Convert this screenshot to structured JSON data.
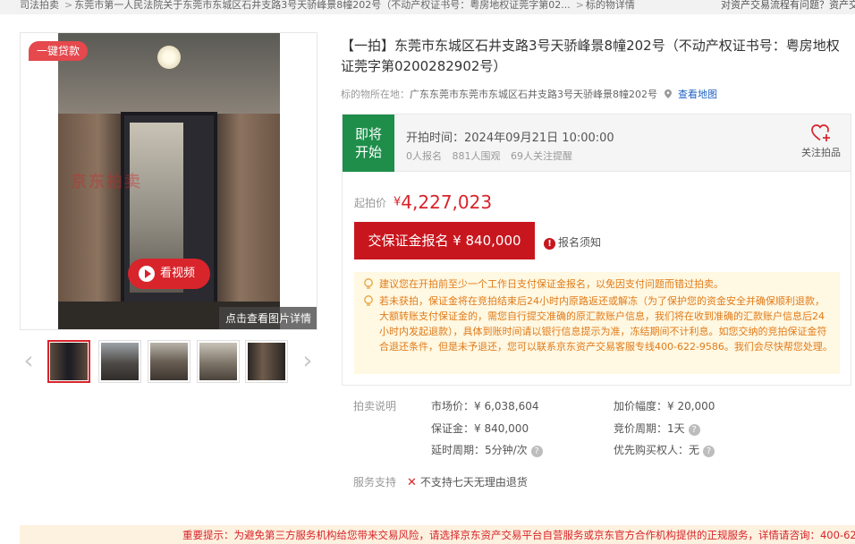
{
  "breadcrumb": {
    "items": [
      "司法拍卖",
      "东莞市第一人民法院关于东莞市东城区石井支路3号天骄峰景8幢202号（不动产权证书号：粤房地权证莞字第02...",
      "标的物详情"
    ],
    "separator": ">",
    "help_text": "对资产交易流程有问题？资产交"
  },
  "gallery": {
    "loan_badge": "一键贷款",
    "video_button": "看视频",
    "photo_detail_link": "点击查看图片详情",
    "watermark": "京东拍卖",
    "thumbnail_count": 5,
    "active_thumbnail": 1
  },
  "listing": {
    "title": "【一拍】东莞市东城区石井支路3号天骄峰景8幢202号（不动产权证书号：粤房地权证莞字第0200282902号）",
    "location_label": "标的物所在地：",
    "location_value": "广东东莞市东莞市东城区石井支路3号天骄峰景8幢202号",
    "map_link": "查看地图"
  },
  "auction": {
    "status_line1": "即将",
    "status_line2": "开始",
    "start_time": "开拍时间：2024年09月21日 10:00:00",
    "signups": "0人报名",
    "views": "881人围观",
    "reminders": "69人关注提醒",
    "follow_label": "关注拍品",
    "starting_price_label": "起拍价",
    "currency": "¥",
    "starting_price": "4,227,023",
    "deposit_button": "交保证金报名 ¥ 840,000",
    "notice_link": "报名须知",
    "tips": [
      "建议您在开拍前至少一个工作日支付保证金报名，以免因支付问题而错过拍卖。",
      "若未获拍，保证金将在竞拍结束后24小时内原路返还或解冻（为了保护您的资金安全并确保顺利退款，大额转账支付保证金的，需您自行提交准确的原汇款账户信息，我们将在收到准确的汇款账户信息后24小时内发起退款），具体到账时间请以银行信息提示为准，冻结期间不计利息。如您交纳的竞拍保证金符合退还条件，但是未予退还，您可以联系京东资产交易客服专线400-622-9586。我们会尽快帮您处理。"
    ]
  },
  "details": {
    "section_label": "拍卖说明",
    "market_price": "市场价：¥ 6,038,604",
    "increment": "加价幅度：¥ 20,000",
    "deposit": "保证金：¥ 840,000",
    "bid_cycle": "竞价周期：1天",
    "extension": "延时周期：5分钟/次",
    "priority_buyer": "优先购买权人：无",
    "service_label": "服务支持",
    "service_value": "不支持七天无理由退货"
  },
  "banner": {
    "text": "重要提示：为避免第三方服务机构给您带来交易风险，请选择京东资产交易平台自营服务或京东官方合作机构提供的正规服务，详情请咨询：400-622"
  },
  "colors": {
    "accent_red": "#c8161e",
    "status_green": "#1e8e4a",
    "tip_orange": "#e07b1a",
    "link_blue": "#1d62c3"
  }
}
